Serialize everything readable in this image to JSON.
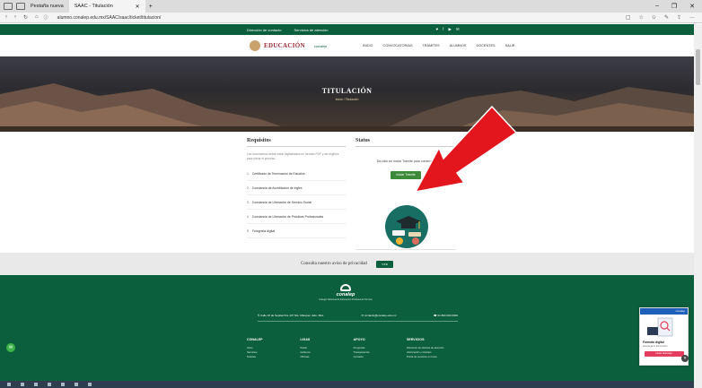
{
  "browser": {
    "tabs": [
      {
        "label": "Pestaña nueva"
      },
      {
        "label": "SAAC - Titulación"
      }
    ],
    "url": "alumno.conalep.edu.mx/SAAC/saac/ticket/titulacion/",
    "window_controls": [
      "–",
      "❐",
      "✕"
    ]
  },
  "site": {
    "top_links": [
      "Dirección de contacto",
      "Servicios de atención"
    ],
    "brand": "EDUCACIÓN",
    "brand_partner": "conalep",
    "menu": [
      "INICIO",
      "CONVOCATORIAS",
      "TRÁMITES",
      "ALUMNOS",
      "DOCENTES",
      "SALIR"
    ]
  },
  "hero": {
    "title": "TITULACIÓN",
    "breadcrumb": "Inicio / Titulación"
  },
  "requisitos": {
    "heading": "Requisitos",
    "description": "Los documentos deben estar digitalizados en formato PDF y ser legibles para iniciar el proceso.",
    "items": [
      {
        "n": "1.",
        "label": "Certificado de Terminación de Estudios"
      },
      {
        "n": "2.",
        "label": "Constancia de Acreditación de Inglés"
      },
      {
        "n": "3.",
        "label": "Constancia de Liberación de Servicio Social"
      },
      {
        "n": "4.",
        "label": "Constancia de Liberación de Prácticas Profesionales"
      },
      {
        "n": "5.",
        "label": "Fotografía digital"
      }
    ]
  },
  "status": {
    "heading": "Status",
    "message": "Da click en Iniciar Trámite para comenzar",
    "button": "Iniciar Trámite"
  },
  "privacy": {
    "text": "Consulta nuestro aviso de privacidad",
    "button": "VER"
  },
  "footer": {
    "brand": "conalep",
    "brand_sub": "Colegio Nacional de Educación Profesional Técnica",
    "address": "Calle 16 de Septiembre 147 Nte. Metepec, Edo. Méx.",
    "email": "contacto@conalep.edu.mx",
    "phone": "01 800 000 0000",
    "columns": [
      {
        "title": "CONALEP",
        "items": [
          "Inicio",
          "Servicios",
          "Noticias"
        ]
      },
      {
        "title": "LIGAS",
        "items": [
          "Portal",
          "Gobierno",
          "Oficinas"
        ]
      },
      {
        "title": "APOYO",
        "items": [
          "Preguntas",
          "Transparencia",
          "Contacto"
        ]
      },
      {
        "title": "SERVICIOS",
        "items": [
          "Directorio de oficinas de atención",
          "Información y trámites",
          "Portal de servicios en línea"
        ]
      }
    ]
  },
  "widget": {
    "header": "conalep",
    "title": "Formato digital",
    "subtitle": "Descarga tu documento",
    "button": "Iniciar descarga"
  },
  "colors": {
    "brand_green": "#0b5f3c",
    "button_green": "#3d8a3b",
    "brand_red": "#9a2b36",
    "arrow_red": "#e3151d"
  }
}
